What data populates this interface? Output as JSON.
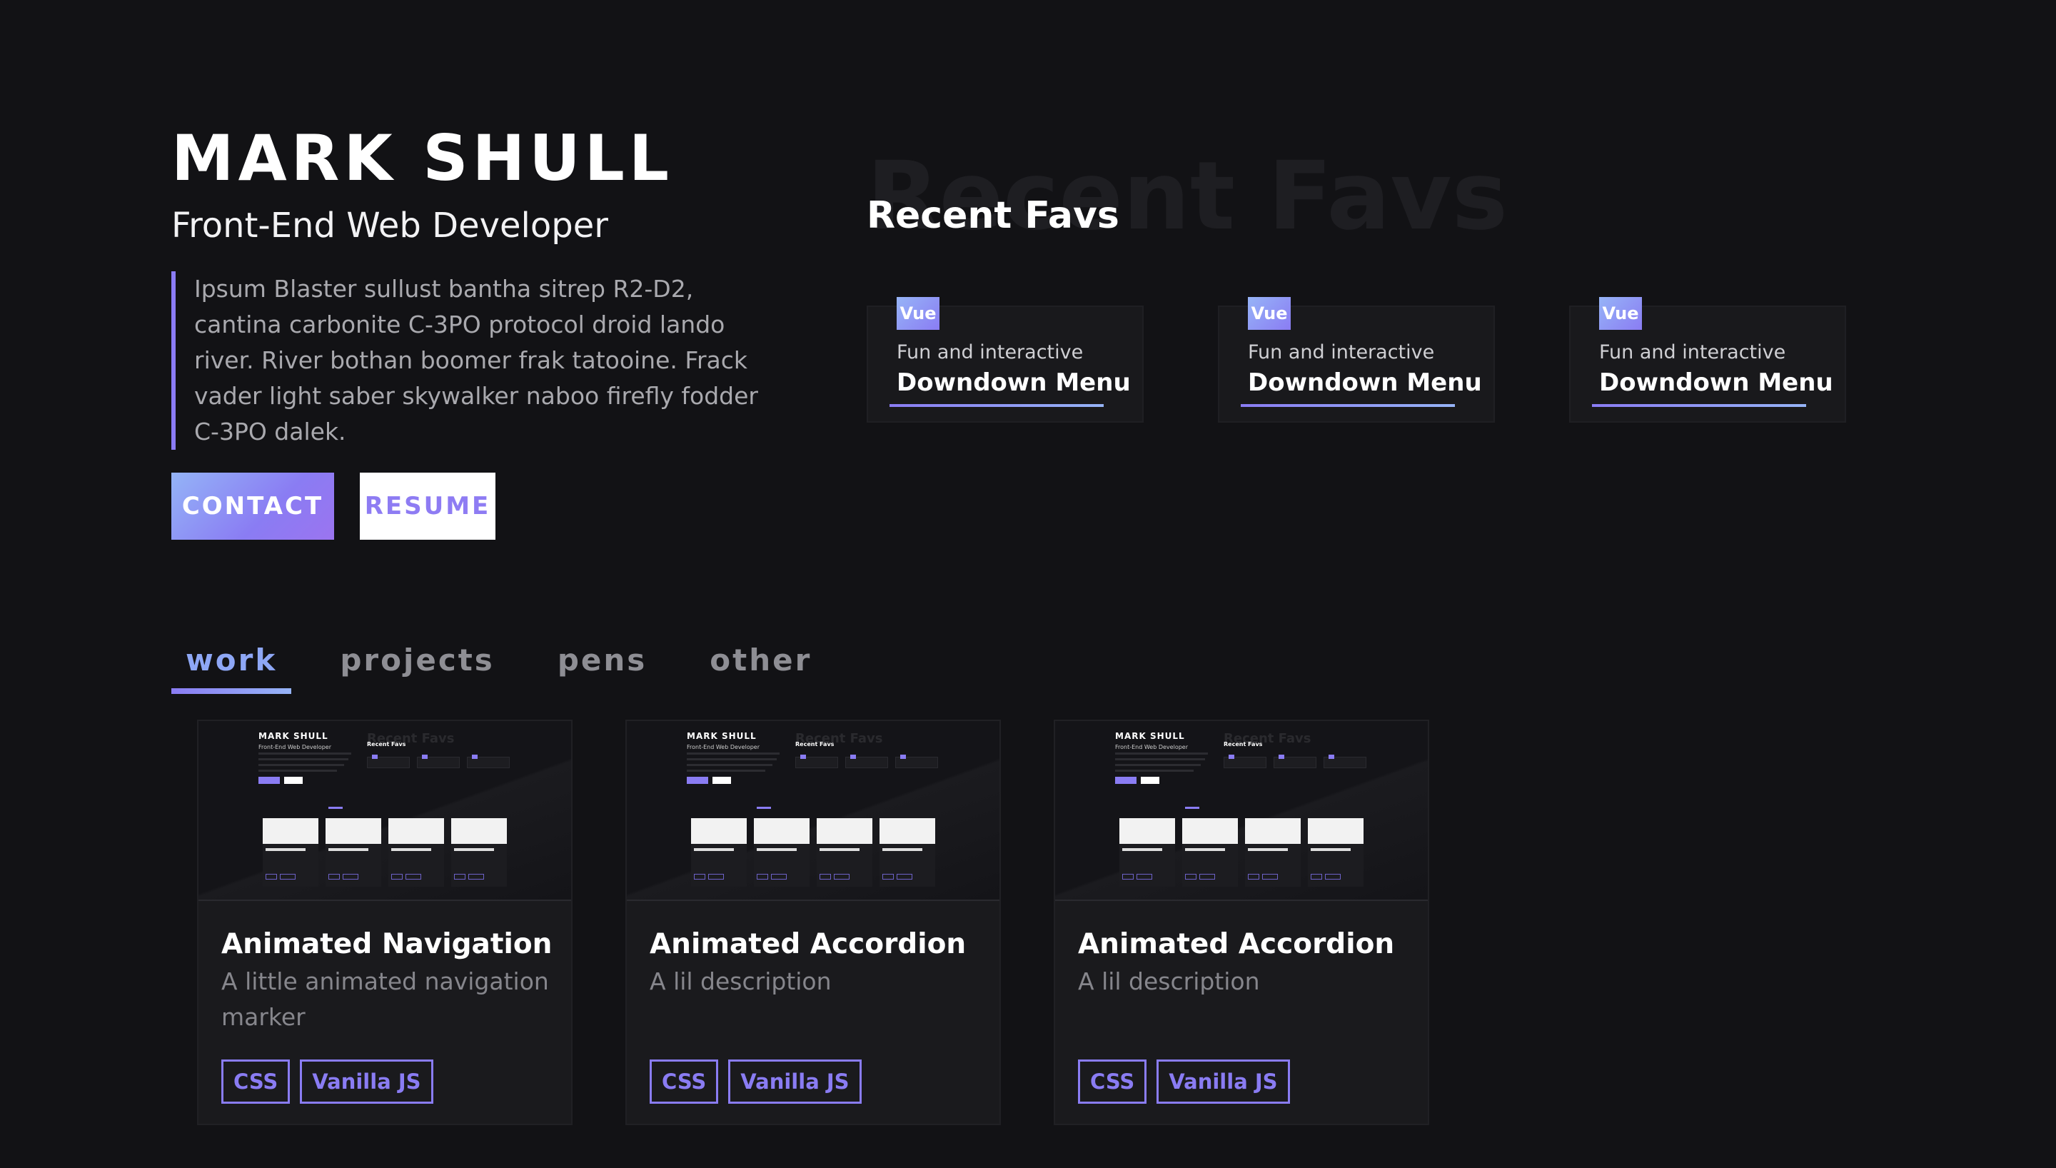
{
  "hero": {
    "name": "MARK SHULL",
    "role": "Front-End Web Developer",
    "bio": "Ipsum Blaster sullust bantha sitrep R2-D2, cantina carbonite C-3PO protocol droid lando river. River bothan boomer frak tatooine. Frack vader light saber skywalker naboo firefly fodder C-3PO dalek.",
    "contact_label": "CONTACT",
    "resume_label": "RESUME"
  },
  "favs": {
    "ghost_title": "Recent Favs",
    "title": "Recent Favs",
    "items": [
      {
        "badge": "Vue",
        "subtitle": "Fun and interactive",
        "name": "Downdown Menu"
      },
      {
        "badge": "Vue",
        "subtitle": "Fun and interactive",
        "name": "Downdown Menu"
      },
      {
        "badge": "Vue",
        "subtitle": "Fun and interactive",
        "name": "Downdown Menu"
      }
    ]
  },
  "tabs": [
    {
      "label": "work",
      "active": true
    },
    {
      "label": "projects",
      "active": false
    },
    {
      "label": "pens",
      "active": false
    },
    {
      "label": "other",
      "active": false
    }
  ],
  "cards": [
    {
      "title": "Animated Navigation",
      "description": "A little animated navigation marker",
      "tags": [
        "CSS",
        "Vanilla JS"
      ]
    },
    {
      "title": "Animated Accordion",
      "description": "A lil description",
      "tags": [
        "CSS",
        "Vanilla JS"
      ]
    },
    {
      "title": "Animated Accordion",
      "description": "A lil description",
      "tags": [
        "CSS",
        "Vanilla JS"
      ]
    }
  ],
  "thumbnail": {
    "name": "MARK SHULL",
    "role": "Front-End Web Developer",
    "favs_title": "Recent Favs"
  },
  "colors": {
    "background": "#121215",
    "accent": "#8a7cf3",
    "accent_light": "#96b4f7"
  }
}
